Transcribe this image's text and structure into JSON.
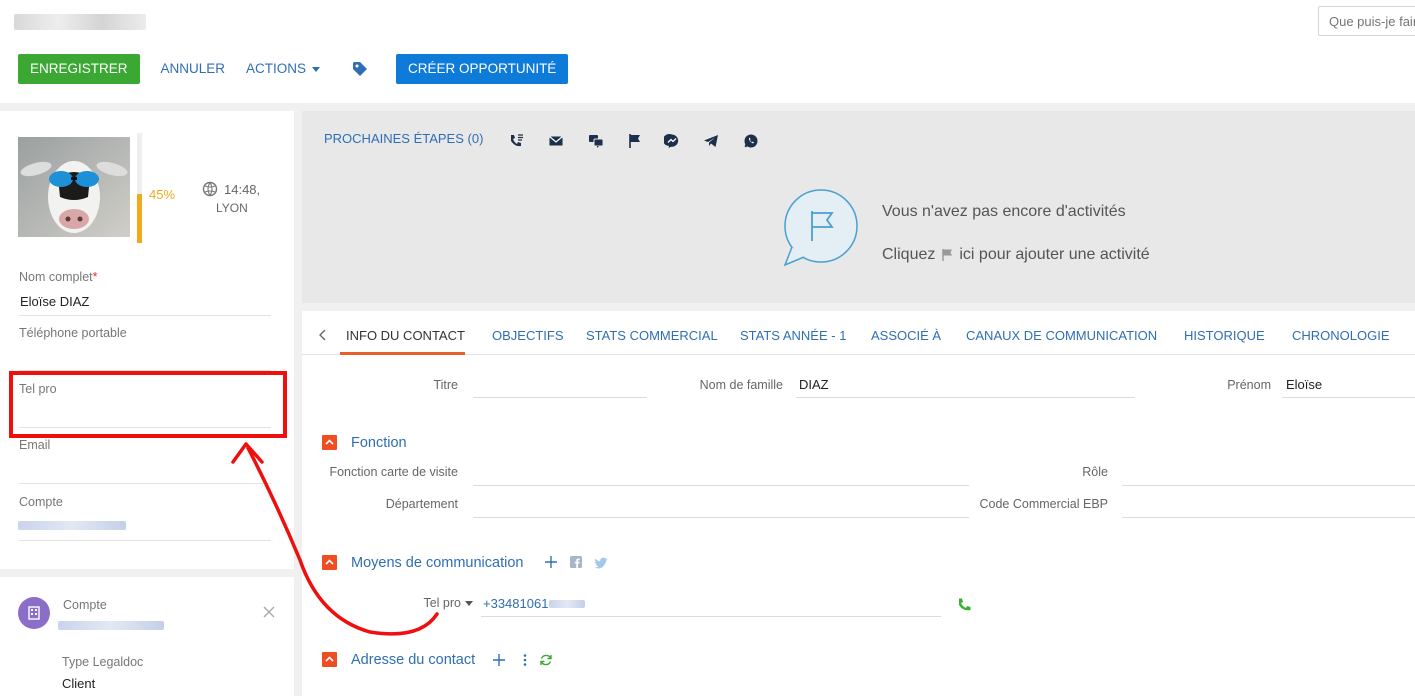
{
  "search": {
    "placeholder": "Que puis-je faire pour vous ?"
  },
  "toolbar": {
    "save_label": "ENREGISTRER",
    "cancel_label": "ANNULER",
    "actions_label": "ACTIONS",
    "create_opportunity_label": "CRÉER OPPORTUNITÉ"
  },
  "profile": {
    "completeness_percent": 45,
    "completeness_label": "45%",
    "time": "14:48,",
    "city": "LYON",
    "fields": {
      "full_name_label": "Nom complet",
      "full_name_required": "*",
      "full_name_value": "Eloïse DIAZ",
      "mobile_label": "Téléphone portable",
      "telpro_label": "Tel pro",
      "email_label": "Email",
      "account_label": "Compte"
    }
  },
  "linkcard": {
    "account_label": "Compte",
    "type_label": "Type Legaldoc",
    "type_value": "Client"
  },
  "activity": {
    "tab_label": "PROCHAINES ÉTAPES (0)",
    "icons": [
      "call-icon",
      "email-icon",
      "chat-icon",
      "flag-icon",
      "messenger-icon",
      "telegram-icon",
      "whatsapp-icon"
    ],
    "empty_line1": "Vous n'avez pas encore d'activités",
    "empty_line2_before": "Cliquez",
    "empty_line2_after": "ici pour ajouter une activité"
  },
  "tabs": [
    {
      "label": "INFO DU CONTACT"
    },
    {
      "label": "OBJECTIFS"
    },
    {
      "label": "STATS COMMERCIAL"
    },
    {
      "label": "STATS ANNÉE - 1"
    },
    {
      "label": "ASSOCIÉ À"
    },
    {
      "label": "CANAUX DE COMMUNICATION"
    },
    {
      "label": "HISTORIQUE"
    },
    {
      "label": "CHRONOLOGIE"
    }
  ],
  "contact": {
    "titre_label": "Titre",
    "nom_label": "Nom de famille",
    "nom_value": "DIAZ",
    "prenom_label": "Prénom",
    "prenom_value": "Eloïse"
  },
  "fonction": {
    "title": "Fonction",
    "carte_label": "Fonction carte de visite",
    "role_label": "Rôle",
    "departement_label": "Département",
    "code_label": "Code Commercial EBP"
  },
  "communication": {
    "title": "Moyens de communication",
    "telpro_label": "Tel pro",
    "telpro_value": "+33481061"
  },
  "adresse": {
    "title": "Adresse du contact"
  },
  "colors": {
    "green": "#3aa832",
    "blue": "#0e7bd8",
    "link": "#2f6eb5",
    "orange": "#ee4e22",
    "highlight": "#ee0f0f",
    "progress": "#f2a91d"
  }
}
